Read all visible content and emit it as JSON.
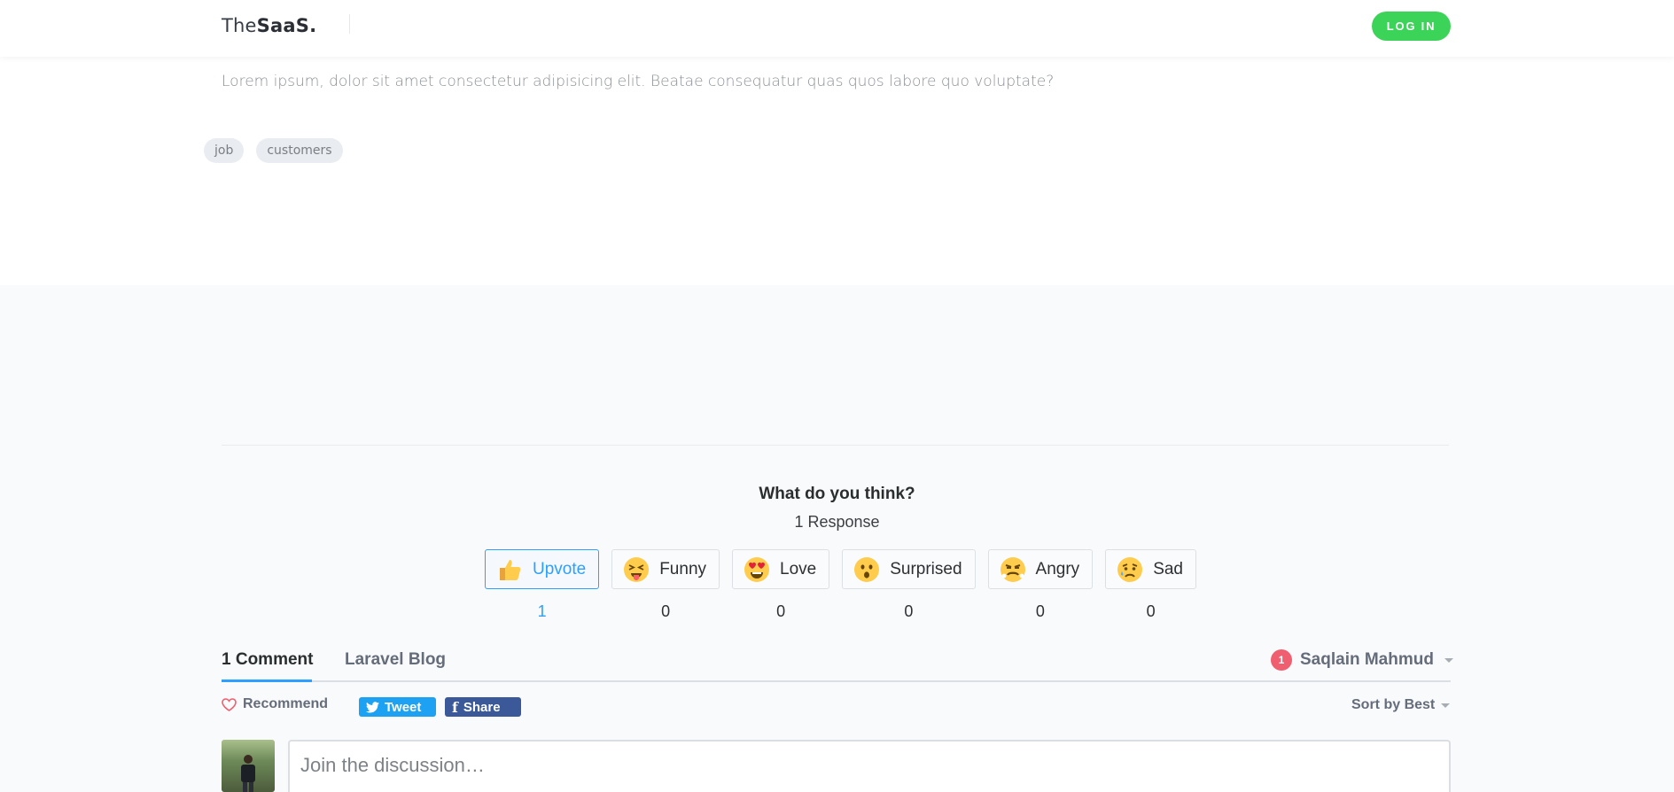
{
  "header": {
    "logo_light": "The",
    "logo_bold": "SaaS.",
    "login_label": "LOG IN"
  },
  "article": {
    "lead": "Lorem ipsum, dolor sit amet consectetur adipisicing elit. Beatae consequatur quas quos labore quo voluptate?",
    "tags": [
      "job",
      "customers"
    ]
  },
  "comments": {
    "question": "What do you think?",
    "response_count": "1 Response",
    "reactions": [
      {
        "label": "Upvote",
        "count": "1",
        "icon": "thumbs-up-icon",
        "active": true
      },
      {
        "label": "Funny",
        "count": "0",
        "icon": "tongue-out-emoji-icon",
        "active": false
      },
      {
        "label": "Love",
        "count": "0",
        "icon": "heart-eyes-emoji-icon",
        "active": false
      },
      {
        "label": "Surprised",
        "count": "0",
        "icon": "surprised-emoji-icon",
        "active": false
      },
      {
        "label": "Angry",
        "count": "0",
        "icon": "angry-emoji-icon",
        "active": false
      },
      {
        "label": "Sad",
        "count": "0",
        "icon": "sad-emoji-icon",
        "active": false
      }
    ],
    "tabs": {
      "comments": "1 Comment",
      "forum": "Laravel Blog"
    },
    "user": {
      "notifications": "1",
      "name": "Saqlain Mahmud"
    },
    "recommend_label": "Recommend",
    "tweet_label": "Tweet",
    "share_label": "Share",
    "sort_label": "Sort by Best",
    "discussion_placeholder": "Join the discussion…"
  },
  "colors": {
    "accent": "#2e9fff",
    "login_green": "#3cd458",
    "badge_red": "#f05f70",
    "twitter": "#1da1f2",
    "facebook": "#3b5999"
  }
}
